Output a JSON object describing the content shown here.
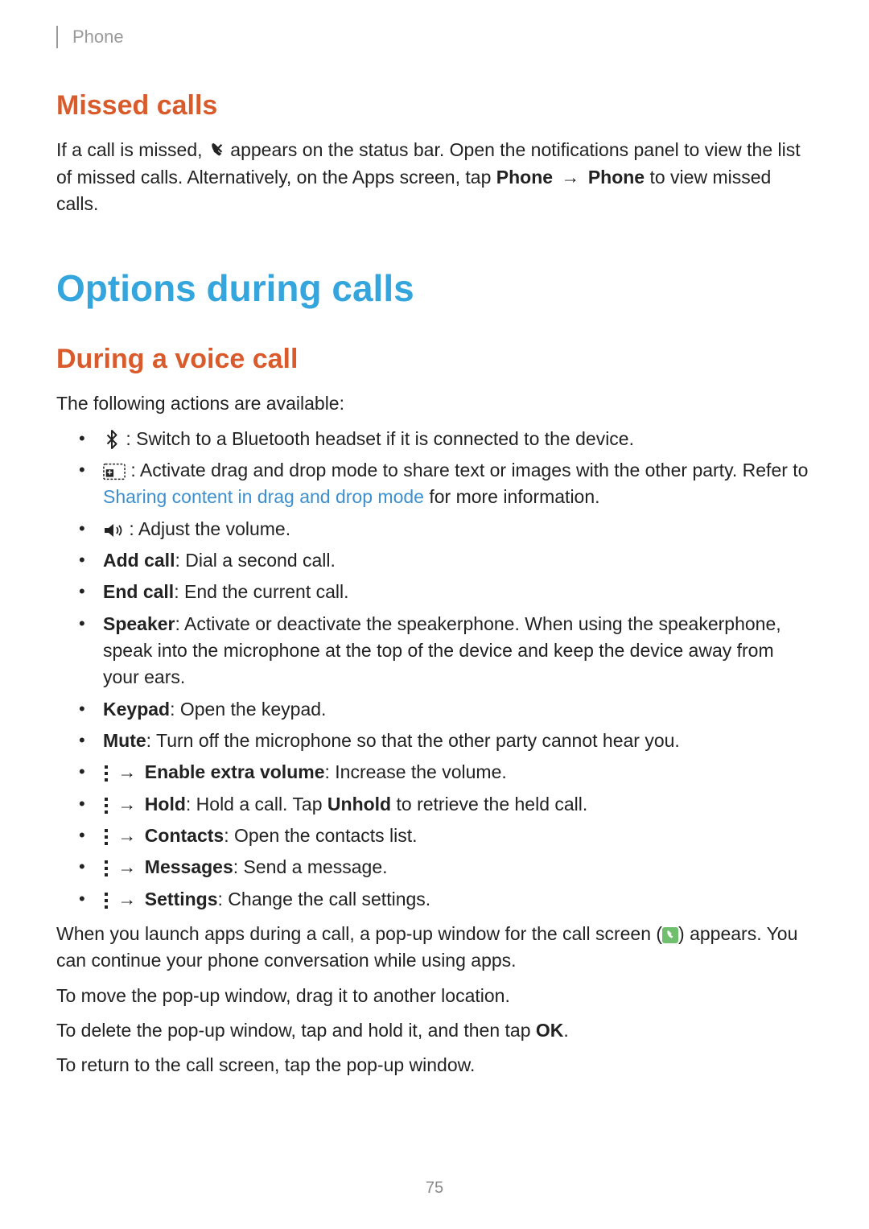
{
  "breadcrumb": "Phone",
  "section_missed": {
    "title": "Missed calls",
    "para1_a": "If a call is missed, ",
    "para1_b": " appears on the status bar. Open the notifications panel to view the list of missed calls. Alternatively, on the Apps screen, tap ",
    "para1_bold1": "Phone",
    "arrow": "→",
    "para1_bold2": "Phone",
    "para1_c": " to view missed calls."
  },
  "main_title": "Options during calls",
  "section_voice": {
    "title": "During a voice call",
    "intro": "The following actions are available:",
    "items": {
      "bt": " : Switch to a Bluetooth headset if it is connected to the device.",
      "drag_a": " : Activate drag and drop mode to share text or images with the other party. Refer to ",
      "drag_link": "Sharing content in drag and drop mode",
      "drag_b": " for more information.",
      "vol": " : Adjust the volume.",
      "addcall_bold": "Add call",
      "addcall": ": Dial a second call.",
      "endcall_bold": "End call",
      "endcall": ": End the current call.",
      "speaker_bold": "Speaker",
      "speaker": ": Activate or deactivate the speakerphone. When using the speakerphone, speak into the microphone at the top of the device and keep the device away from your ears.",
      "keypad_bold": "Keypad",
      "keypad": ": Open the keypad.",
      "mute_bold": "Mute",
      "mute": ": Turn off the microphone so that the other party cannot hear you.",
      "extra_bold": "Enable extra volume",
      "extra": ": Increase the volume.",
      "hold_bold": "Hold",
      "hold_a": ": Hold a call. Tap ",
      "unhold_bold": "Unhold",
      "hold_b": " to retrieve the held call.",
      "contacts_bold": "Contacts",
      "contacts": ": Open the contacts list.",
      "messages_bold": "Messages",
      "messages": ": Send a message.",
      "settings_bold": "Settings",
      "settings": ": Change the call settings."
    },
    "para_popup_a": "When you launch apps during a call, a pop-up window for the call screen (",
    "para_popup_b": ") appears. You can continue your phone conversation while using apps.",
    "para_move": "To move the pop-up window, drag it to another location.",
    "para_delete_a": "To delete the pop-up window, tap and hold it, and then tap ",
    "para_delete_bold": "OK",
    "para_delete_b": ".",
    "para_return": "To return to the call screen, tap the pop-up window."
  },
  "arrow": "→",
  "page_number": "75"
}
